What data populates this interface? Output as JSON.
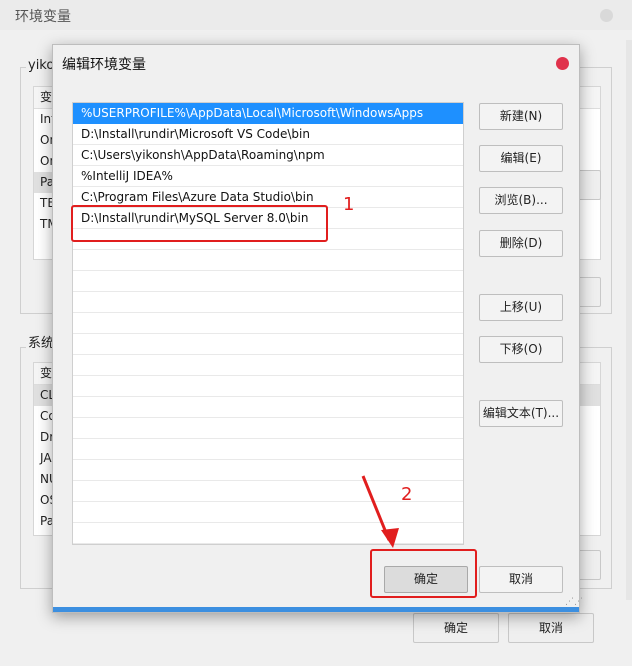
{
  "background_window": {
    "title": "环境变量",
    "user_group_label": "yiko",
    "user_list": {
      "header": "变",
      "rows": [
        "Int",
        "On",
        "On",
        "Pa",
        "TE",
        "TM"
      ]
    },
    "system_group_label": "系统",
    "system_list": {
      "header": "变",
      "rows": [
        "CL",
        "Co",
        "Dr",
        "JA",
        "NU",
        "OS",
        "Pa"
      ]
    },
    "ok_label": "确定",
    "cancel_label": "取消"
  },
  "dialog": {
    "title": "编辑环境变量",
    "paths": [
      "%USERPROFILE%\\AppData\\Local\\Microsoft\\WindowsApps",
      "D:\\Install\\rundir\\Microsoft VS Code\\bin",
      "C:\\Users\\yikonsh\\AppData\\Roaming\\npm",
      "%IntelliJ IDEA%",
      "C:\\Program Files\\Azure Data Studio\\bin",
      "D:\\Install\\rundir\\MySQL Server 8.0\\bin"
    ],
    "selected_index": 0,
    "buttons": {
      "new": "新建(N)",
      "edit": "编辑(E)",
      "browse": "浏览(B)...",
      "delete": "删除(D)",
      "move_up": "上移(U)",
      "move_down": "下移(O)",
      "edit_text": "编辑文本(T)...",
      "ok": "确定",
      "cancel": "取消"
    }
  },
  "annotations": {
    "label_1": "1",
    "label_2": "2",
    "color": "#e11e1e"
  }
}
